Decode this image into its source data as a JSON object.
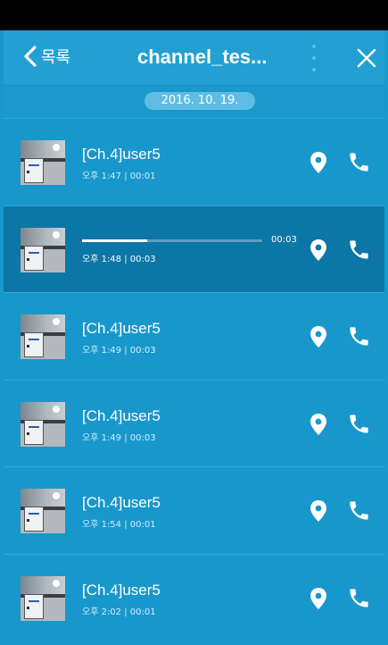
{
  "header": {
    "back_label": "목록",
    "title": "channel_tes...",
    "back_icon": "chevron-left-icon",
    "menu_icon": "more-vertical-icon",
    "close_icon": "close-icon"
  },
  "date": "2016. 10. 19.",
  "colors": {
    "background": "#1897cc",
    "header": "#22a0d4",
    "active_row": "#0c76a6",
    "date_pill": "#5fbde3"
  },
  "messages": [
    {
      "name": "[Ch.4]user5",
      "meta": "오후 1:47 | 00:01",
      "playing": false
    },
    {
      "name": "",
      "meta": "오후 1:48 | 00:03",
      "playing": true,
      "progress": 0.36,
      "duration": "00:03"
    },
    {
      "name": "[Ch.4]user5",
      "meta": "오후 1:49 | 00:03",
      "playing": false
    },
    {
      "name": "[Ch.4]user5",
      "meta": "오후 1:49 | 00:03",
      "playing": false
    },
    {
      "name": "[Ch.4]user5",
      "meta": "오후 1:54 | 00:01",
      "playing": false
    },
    {
      "name": "[Ch.4]user5",
      "meta": "오후 2:02 | 00:01",
      "playing": false
    }
  ]
}
